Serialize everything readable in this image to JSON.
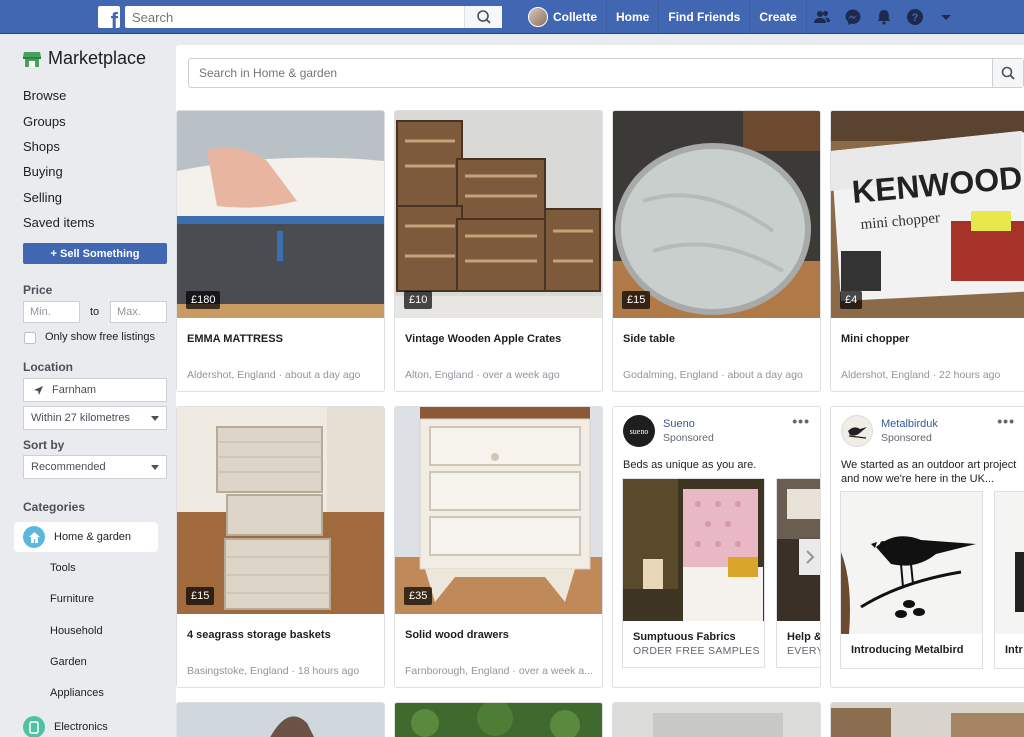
{
  "topbar": {
    "search_placeholder": "Search",
    "user_name": "Collette",
    "nav": [
      "Home",
      "Find Friends",
      "Create"
    ]
  },
  "sidebar": {
    "title": "Marketplace",
    "links": [
      "Browse",
      "Groups",
      "Shops",
      "Buying",
      "Selling",
      "Saved items"
    ],
    "sell_button": "+ Sell Something",
    "price_heading": "Price",
    "price_min": "Min.",
    "price_to": "to",
    "price_max": "Max.",
    "free_only": "Only show free listings",
    "location_heading": "Location",
    "location_value": "Farnham",
    "radius_value": "Within 27 kilometres",
    "sort_heading": "Sort by",
    "sort_value": "Recommended",
    "categories_heading": "Categories",
    "active_category": "Home & garden",
    "sub_categories": [
      "Tools",
      "Furniture",
      "Household",
      "Garden",
      "Appliances"
    ],
    "next_category": "Electronics"
  },
  "main": {
    "search_placeholder": "Search in Home & garden",
    "listings": [
      {
        "price": "£180",
        "title": "EMMA MATTRESS",
        "meta": "Aldershot, England · about a day ago"
      },
      {
        "price": "£10",
        "title": "Vintage Wooden Apple Crates",
        "meta": "Alton, England · over a week ago"
      },
      {
        "price": "£15",
        "title": "Side table",
        "meta": "Godalming, England · about a day ago"
      },
      {
        "price": "£4",
        "title": "Mini chopper",
        "meta": "Aldershot, England · 22 hours ago"
      },
      {
        "price": "£15",
        "title": "4 seagrass storage baskets",
        "meta": "Basingstoke, England · 18 hours ago"
      },
      {
        "price": "£35",
        "title": "Solid wood drawers",
        "meta": "Farnborough, England · over a week a..."
      }
    ],
    "ads": [
      {
        "name": "Sueno",
        "sponsored": "Sponsored",
        "dots": "•••",
        "logo_text": "sueno",
        "text": "Beds as unique as you are.",
        "item1_title": "Sumptuous Fabrics",
        "item1_sub": "ORDER FREE SAMPLES",
        "item2_title": "Help &",
        "item2_sub": "EVERY"
      },
      {
        "name": "Metalbirduk",
        "sponsored": "Sponsored",
        "dots": "•••",
        "text": "We started as an outdoor art project and now we're here in the UK...",
        "item1_title": "Introducing Metalbird",
        "item2_title": "Intr"
      }
    ],
    "product_images": {
      "kenwood_brand": "KENWOOD",
      "kenwood_sub": "mini chopper"
    }
  }
}
